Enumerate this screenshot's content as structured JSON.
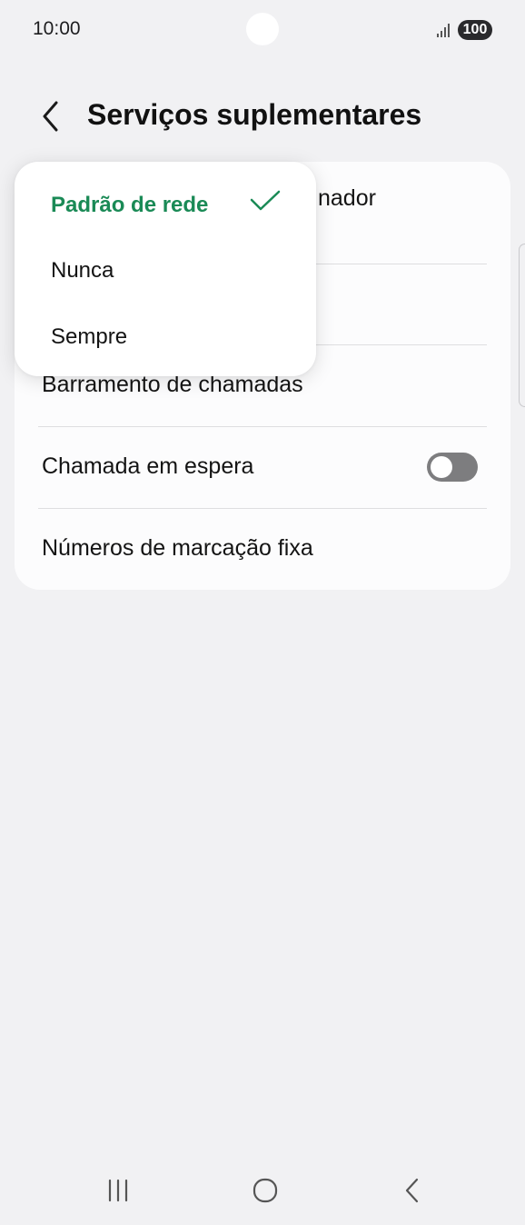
{
  "status_bar": {
    "time": "10:00",
    "battery": "100",
    "icons": {
      "signal": "signal-bars-icon",
      "camera": "camera-cutout"
    }
  },
  "header": {
    "title": "Serviços suplementares",
    "back_icon": "chevron-left-icon"
  },
  "settings": {
    "items": [
      {
        "label": "Mostrar meu ID de chamador"
      },
      {
        "label": ""
      },
      {
        "label": "Barramento de chamadas"
      },
      {
        "label": "Chamada em espera",
        "toggle": false
      },
      {
        "label": "Números de marcação fixa"
      }
    ],
    "first_item_visible_fragment": "nador"
  },
  "popup_menu": {
    "options": [
      {
        "label": "Padrão de rede",
        "selected": true
      },
      {
        "label": "Nunca",
        "selected": false
      },
      {
        "label": "Sempre",
        "selected": false
      }
    ],
    "selected_color": "#1a8a56",
    "check_icon": "check-icon"
  },
  "navigation": {
    "recents_icon": "recents-icon",
    "home_icon": "home-icon",
    "back_icon": "back-nav-icon"
  },
  "colors": {
    "background": "#f1f1f3",
    "card": "#fcfcfd",
    "accent": "#1a8a56",
    "toggle_off": "#7d7d7f"
  }
}
